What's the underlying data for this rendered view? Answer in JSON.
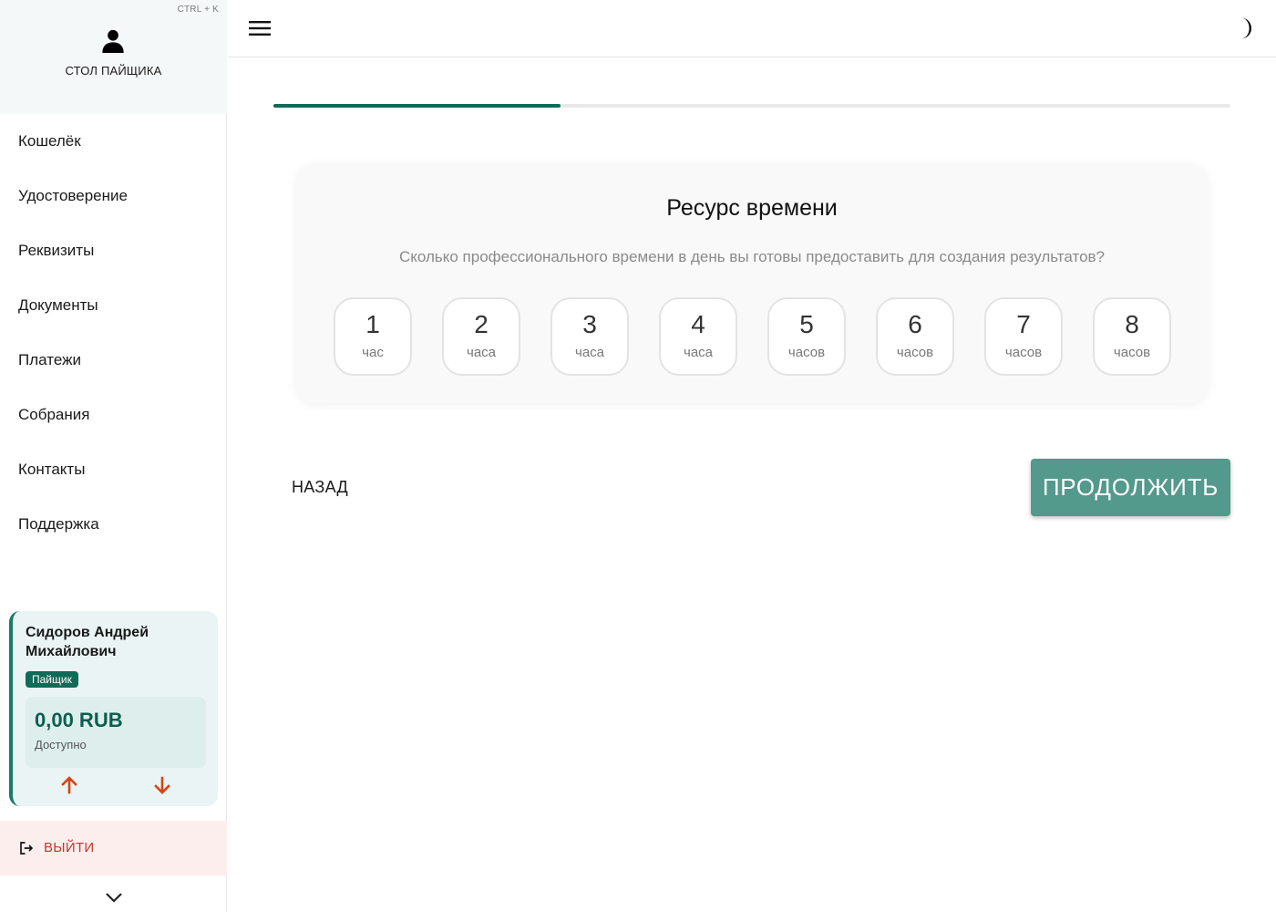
{
  "sidebar": {
    "shortcut_hint": "CTRL + K",
    "title": "СТОЛ ПАЙЩИКА",
    "items": [
      {
        "label": "Кошелёк"
      },
      {
        "label": "Удостоверение"
      },
      {
        "label": "Реквизиты"
      },
      {
        "label": "Документы"
      },
      {
        "label": "Платежи"
      },
      {
        "label": "Собрания"
      },
      {
        "label": "Контакты"
      },
      {
        "label": "Поддержка"
      }
    ],
    "profile": {
      "name": "Сидоров Андрей Михайлович",
      "role": "Пайщик",
      "balance": "0,00 RUB",
      "balance_label": "Доступно"
    },
    "logout_label": "ВЫЙТИ"
  },
  "progress": {
    "value": 0.3
  },
  "card": {
    "title": "Ресурс времени",
    "subtitle": "Сколько профессионального времени в день вы готовы предоставить для создания результатов?",
    "options": [
      {
        "num": "1",
        "unit": "час"
      },
      {
        "num": "2",
        "unit": "часа"
      },
      {
        "num": "3",
        "unit": "часа"
      },
      {
        "num": "4",
        "unit": "часа"
      },
      {
        "num": "5",
        "unit": "часов"
      },
      {
        "num": "6",
        "unit": "часов"
      },
      {
        "num": "7",
        "unit": "часов"
      },
      {
        "num": "8",
        "unit": "часов"
      }
    ]
  },
  "actions": {
    "back_label": "НАЗАД",
    "continue_label": "ПРОДОЛЖИТЬ"
  },
  "colors": {
    "accent": "#0f6b57",
    "button": "#53998c",
    "logout": "#c0392b",
    "arrows": "#d84315"
  },
  "icons": {
    "user": "user-icon",
    "menu": "hamburger-menu-icon",
    "theme": "moon-icon",
    "deposit": "arrow-up-icon",
    "withdraw": "arrow-down-icon",
    "logout": "logout-icon",
    "collapse": "chevron-down-icon"
  }
}
